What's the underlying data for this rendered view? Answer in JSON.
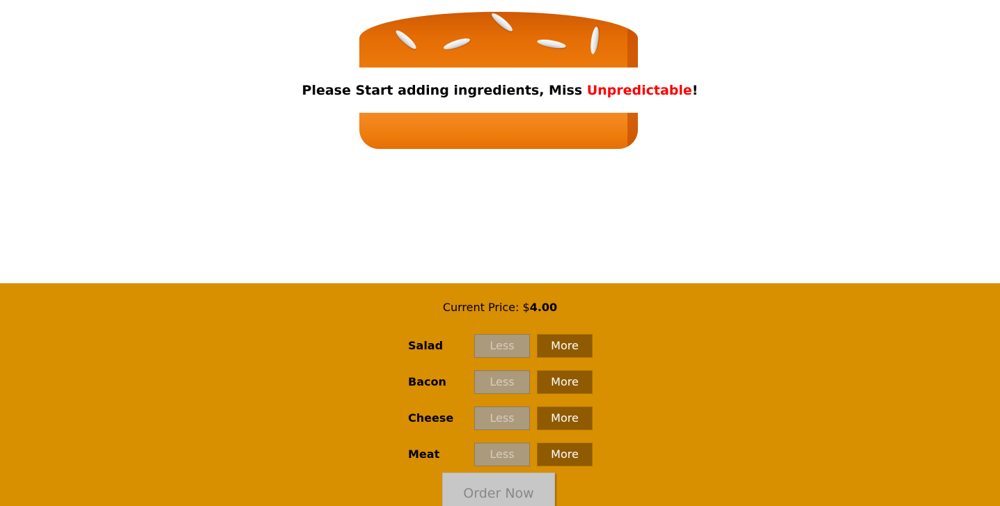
{
  "burger": {
    "empty_message_prefix": "Please Start adding ingredients, Miss ",
    "customer_name": "Unpredictable",
    "empty_message_suffix": "!"
  },
  "build_controls": {
    "price_label": "Current Price: $",
    "price_value": "4.00",
    "ingredients": [
      {
        "label": "Salad",
        "less_label": "Less",
        "more_label": "More",
        "less_disabled": true
      },
      {
        "label": "Bacon",
        "less_label": "Less",
        "more_label": "More",
        "less_disabled": true
      },
      {
        "label": "Cheese",
        "less_label": "Less",
        "more_label": "More",
        "less_disabled": true
      },
      {
        "label": "Meat",
        "less_label": "Less",
        "more_label": "More",
        "less_disabled": true
      }
    ],
    "order_button_label": "Order Now",
    "order_disabled": true
  },
  "colors": {
    "controls_background": "#d88f00",
    "more_button": "#8f5a00",
    "less_button_disabled": "#ac9a7d",
    "bread": "#e46c05",
    "customer_name": "#ff0000"
  },
  "icons": [
    "sesame-seed-icon"
  ]
}
